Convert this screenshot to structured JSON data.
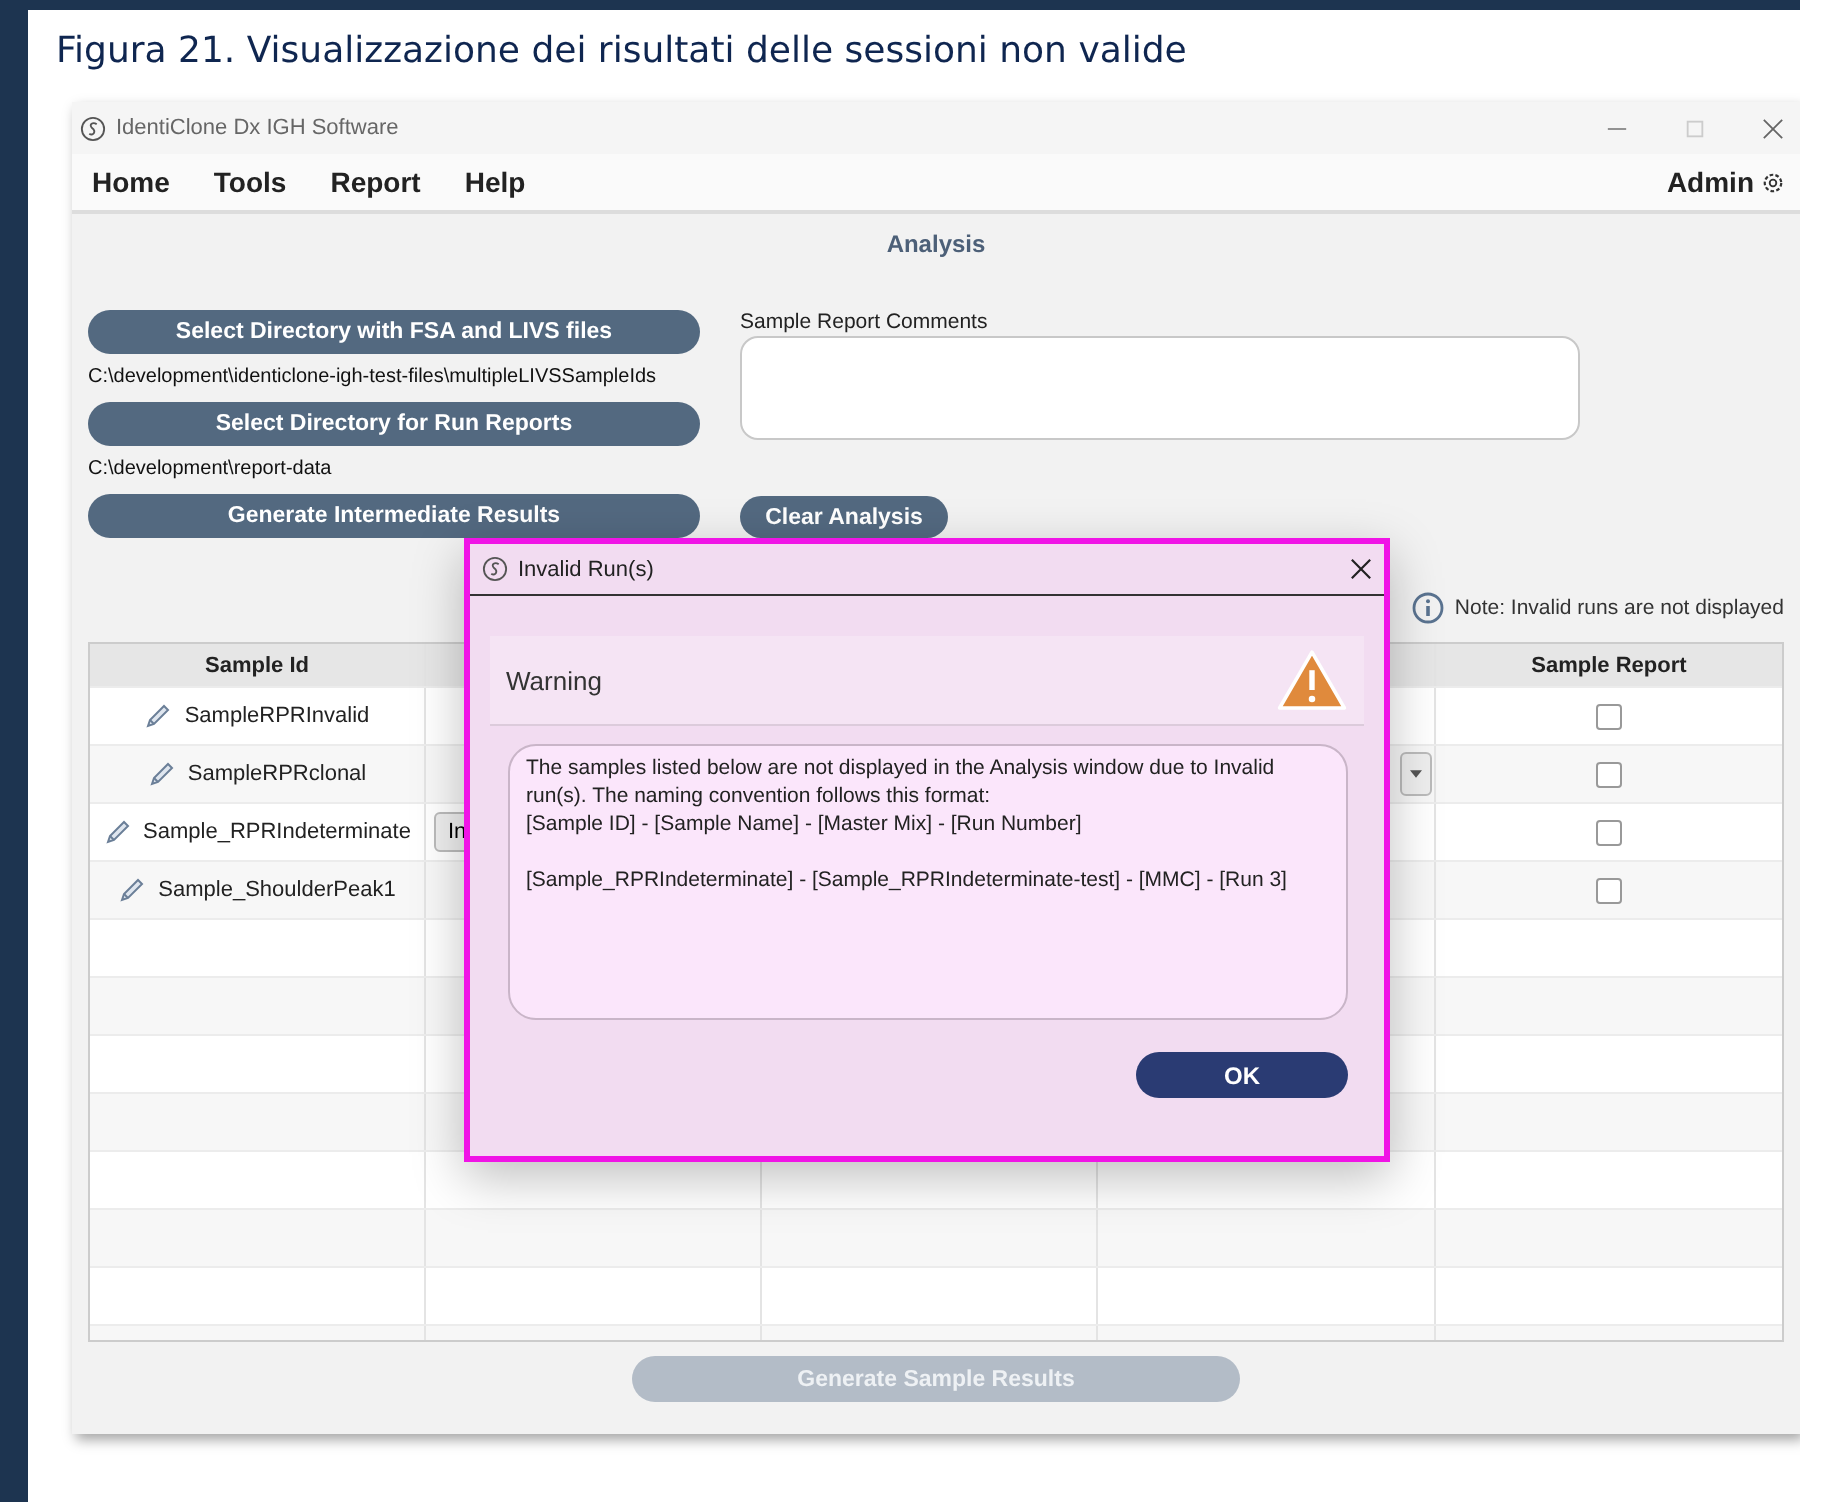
{
  "figure_caption": "Figura 21.  Visualizzazione dei risultati delle sessioni non valide",
  "window": {
    "title": "IdentiClone Dx IGH Software"
  },
  "menu": {
    "items": [
      "Home",
      "Tools",
      "Report",
      "Help"
    ],
    "user": "Admin"
  },
  "page_title": "Analysis",
  "left_panel": [
    {
      "kind": "button",
      "text": "Select Directory with FSA and LIVS files"
    },
    {
      "kind": "path",
      "text": "C:\\development\\identiclone-igh-test-files\\multipleLIVSSampleIds"
    },
    {
      "kind": "button",
      "text": "Select Directory for Run Reports"
    },
    {
      "kind": "path",
      "text": "C:\\development\\report-data"
    },
    {
      "kind": "button",
      "text": "Generate Intermediate Results"
    }
  ],
  "comments": {
    "label": "Sample Report Comments"
  },
  "clear_button": "Clear Analysis",
  "note": "Note: Invalid runs are not displayed",
  "table": {
    "column_1": "Sample Id",
    "column_5": "Sample Report",
    "rows": [
      {
        "sample_id": "SampleRPRInvalid",
        "report_checked": false
      },
      {
        "sample_id": "SampleRPRclonal",
        "column_4": {
          "kind": "dropdown"
        },
        "report_checked": false
      },
      {
        "sample_id": "Sample_RPRIndeterminate",
        "column_2": {
          "kind": "button",
          "text": "In"
        },
        "report_checked": false
      },
      {
        "sample_id": "Sample_ShoulderPeak1",
        "report_checked": false
      }
    ]
  },
  "generate_button": {
    "text": "Generate Sample Results",
    "disabled": true
  },
  "dialog": {
    "title": "Invalid Run(s)",
    "heading": "Warning",
    "message_blocks": [
      [
        "The samples listed below are not displayed in the Analysis window due to Invalid run(s). The naming convention follows this format:",
        "[Sample ID] - [Sample Name] - [Master Mix] - [Run Number]"
      ],
      [
        "[Sample_RPRIndeterminate] - [Sample_RPRIndeterminate-test] - [MMC] - [Run 3]"
      ]
    ],
    "button": "OK"
  }
}
